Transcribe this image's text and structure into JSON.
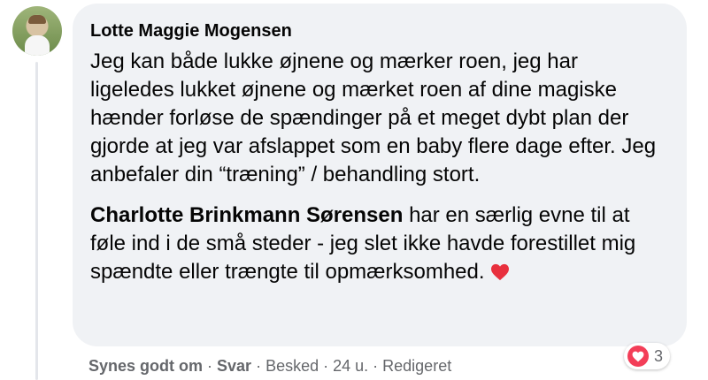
{
  "comment": {
    "author": "Lotte Maggie Mogensen",
    "paragraph1": "Jeg kan både lukke øjnene og mærker roen, jeg har ligeledes lukket øjnene og mærket roen af dine magiske hænder forløse de spændinger på et meget dybt plan der gjorde at jeg var afslappet som en baby flere dage efter. Jeg anbefaler din “træning” / behandling stort.",
    "mention": "Charlotte Brinkmann Sørensen",
    "paragraph2": " har en særlig evne til at føle ind i de små steder - jeg slet ikke havde forestillet mig spændte eller trængte til opmærksomhed.",
    "emoji": "red-heart-icon"
  },
  "reactions": {
    "type": "love-icon",
    "count": "3"
  },
  "actions": {
    "like": "Synes godt om",
    "reply": "Svar",
    "message": "Besked",
    "time": "24 u.",
    "edited": "Redigeret",
    "separator": "·"
  },
  "colors": {
    "love": "#f33e58",
    "bubble": "#f0f2f5",
    "meta": "#65676b"
  }
}
